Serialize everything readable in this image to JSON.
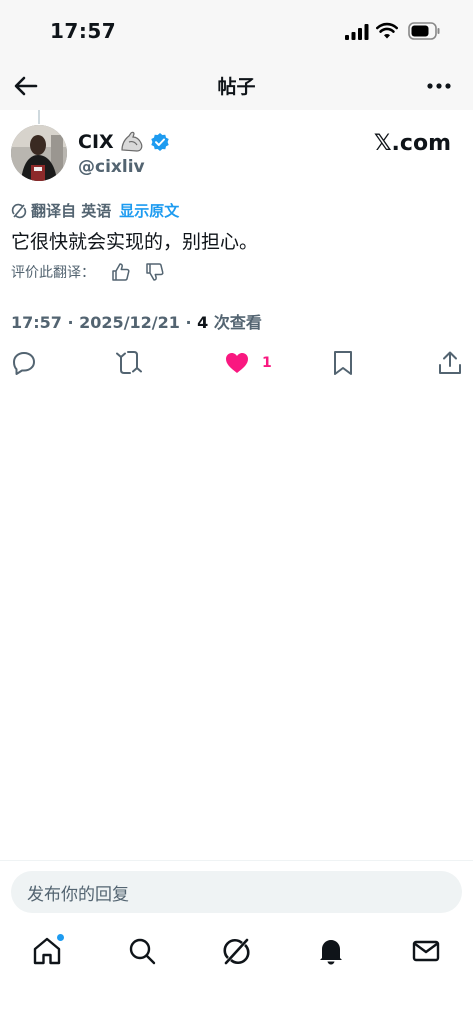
{
  "status_bar": {
    "time": "17:57"
  },
  "nav": {
    "title": "帖子"
  },
  "author": {
    "name": "CIX",
    "handle": "@cixliv",
    "badge_emoji": "💪",
    "verified": true,
    "brand": "𝕏.com"
  },
  "translation": {
    "from_label": "翻译自 英语",
    "show_original": "显示原文",
    "text": "它很快就会实现的，别担心。",
    "rate_label": "评价此翻译："
  },
  "meta": {
    "time": "17:57",
    "date": "2025/12/21",
    "separator": " · ",
    "views_count": "4",
    "views_label": " 次查看"
  },
  "actions": {
    "like_count": "1",
    "icons": [
      "reply-icon",
      "retweet-icon",
      "like-icon",
      "bookmark-icon",
      "share-icon"
    ]
  },
  "reply": {
    "placeholder": "发布你的回复"
  },
  "tabbar": {
    "icons": [
      "home-icon",
      "search-icon",
      "grok-icon",
      "notifications-icon",
      "messages-icon"
    ]
  },
  "colors": {
    "accent": "#1d9bf0",
    "like": "#f91880",
    "muted": "#536471",
    "text": "#0f1419"
  }
}
